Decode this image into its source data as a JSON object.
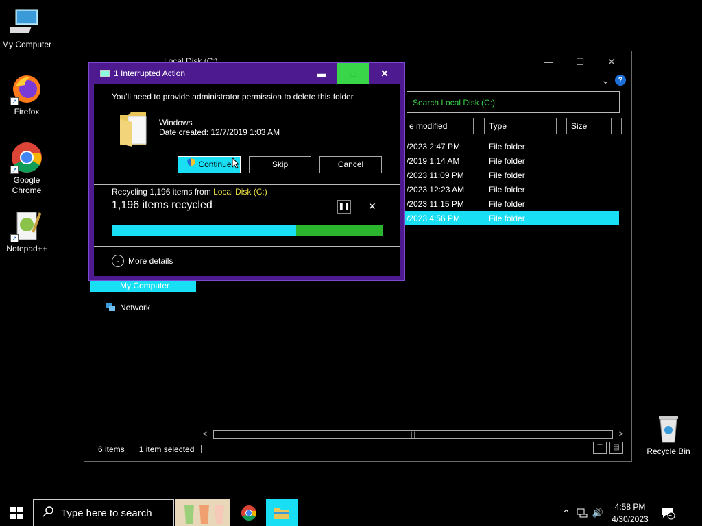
{
  "desktop": {
    "icons": [
      {
        "label": "My Computer"
      },
      {
        "label": "Firefox"
      },
      {
        "label": "Google Chrome"
      },
      {
        "label": "Notepad++"
      },
      {
        "label": "Recycle Bin"
      }
    ]
  },
  "explorer": {
    "title": "Local Disk (C:)",
    "search_placeholder": "Search Local Disk (C:)",
    "columns": {
      "modified": "e modified",
      "type": "Type",
      "size": "Size"
    },
    "rows": [
      {
        "modified": "/2023 2:47 PM",
        "type": "File folder"
      },
      {
        "modified": "/2019 1:14 AM",
        "type": "File folder"
      },
      {
        "modified": "/2023 11:09 PM",
        "type": "File folder"
      },
      {
        "modified": "/2023 12:23 AM",
        "type": "File folder"
      },
      {
        "modified": "/2023 11:15 PM",
        "type": "File folder"
      },
      {
        "modified": "/2023 4:56 PM",
        "type": "File folder"
      }
    ],
    "nav": {
      "my_computer": "My Computer",
      "network": "Network"
    },
    "status": {
      "items": "6 items",
      "selected": "1 item selected"
    }
  },
  "dialog": {
    "title": "1 Interrupted Action",
    "message": "You'll need to provide administrator permission to delete this folder",
    "folder_name": "Windows",
    "date_created": "Date created: 12/7/2019 1:03 AM",
    "buttons": {
      "continue": "Continue",
      "skip": "Skip",
      "cancel": "Cancel"
    },
    "recycling_prefix": "Recycling 1,196 items from ",
    "recycling_location": "Local Disk (C:)",
    "recycled_count": "1,196 items recycled",
    "progress_fraction": 0.68,
    "more_details": "More details"
  },
  "taskbar": {
    "search_placeholder": "Type here to search",
    "time": "4:58 PM",
    "date": "4/30/2023",
    "notification_count": "1"
  },
  "colors": {
    "accent": "#19dff5",
    "dialog_frame": "#4d1a8f",
    "progress_done": "#2bb52e",
    "highlight_green": "#3ad64a"
  }
}
